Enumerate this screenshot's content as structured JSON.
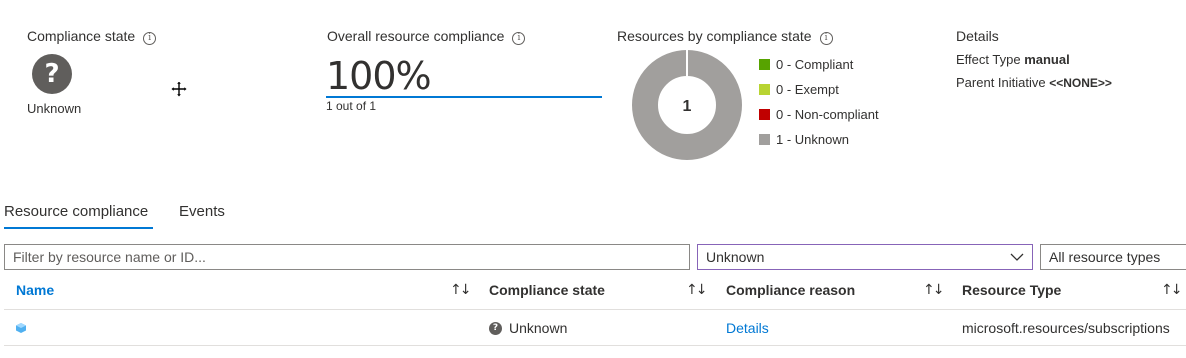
{
  "summary": {
    "compliance_state": {
      "title": "Compliance state",
      "value": "Unknown",
      "icon": "question-icon"
    },
    "overall": {
      "title": "Overall resource compliance",
      "percent": "100%",
      "sub": "1 out of 1"
    },
    "by_state": {
      "title": "Resources by compliance state",
      "center": "1",
      "legend": [
        {
          "label": "0 - Compliant",
          "color": "#57a300"
        },
        {
          "label": "0 - Exempt",
          "color": "#b8d432"
        },
        {
          "label": "0 - Non-compliant",
          "color": "#c00000"
        },
        {
          "label": "1 - Unknown",
          "color": "#a19f9d"
        }
      ]
    },
    "details": {
      "title": "Details",
      "effect_label": "Effect Type",
      "effect_value": "manual",
      "parent_label": "Parent Initiative",
      "parent_value": "<<NONE>>"
    }
  },
  "tabs": [
    {
      "label": "Resource compliance",
      "active": true
    },
    {
      "label": "Events",
      "active": false
    }
  ],
  "filters": {
    "search_placeholder": "Filter by resource name or ID...",
    "state_value": "Unknown",
    "type_value": "All resource types"
  },
  "table": {
    "columns": [
      "Name",
      "Compliance state",
      "Compliance reason",
      "Resource Type"
    ],
    "rows": [
      {
        "name": "",
        "state": "Unknown",
        "reason": "Details",
        "type": "microsoft.resources/subscriptions"
      }
    ]
  },
  "colors": {
    "accent": "#0078d4",
    "active_tab": "#0078d4",
    "unknown_gray": "#a19f9d",
    "dropdown_border": "#8764b8"
  }
}
